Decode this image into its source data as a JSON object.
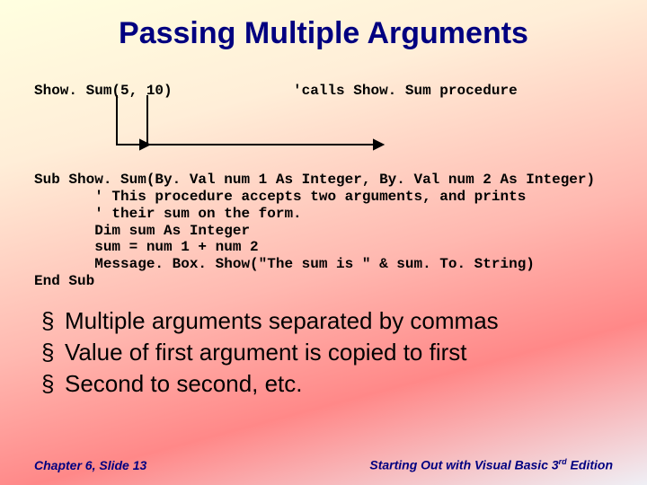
{
  "title": "Passing Multiple Arguments",
  "call": {
    "invoke": "Show. Sum(5, 10)",
    "comment": "'calls Show. Sum procedure"
  },
  "code": {
    "l1": "Sub Show. Sum(By. Val num 1 As Integer, By. Val num 2 As Integer)",
    "l2": "       ' This procedure accepts two arguments, and prints",
    "l3": "       ' their sum on the form.",
    "l4": "       Dim sum As Integer",
    "l5": "       sum = num 1 + num 2",
    "l6": "       Message. Box. Show(\"The sum is \" & sum. To. String)",
    "l7": "End Sub"
  },
  "bullets": {
    "b1": "Multiple arguments separated by commas",
    "b2": "Value of first argument is copied to first",
    "b3": "Second to second, etc."
  },
  "footer": {
    "left": "Chapter 6, Slide 13",
    "right_pre": "Starting Out with Visual Basic 3",
    "right_sup": "rd",
    "right_post": " Edition"
  }
}
